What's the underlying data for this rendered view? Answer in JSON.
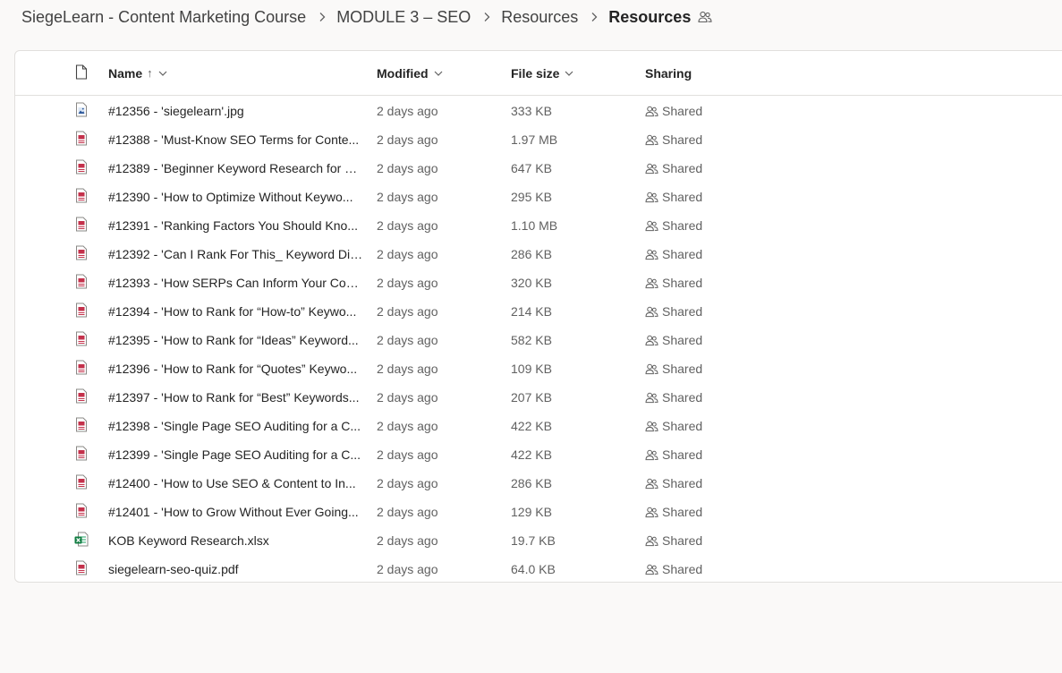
{
  "breadcrumb": {
    "items": [
      "SiegeLearn - Content Marketing Course",
      "MODULE 3 – SEO",
      "Resources"
    ],
    "current": "Resources"
  },
  "columns": {
    "name": "Name",
    "name_sort_arrow": "↑",
    "modified": "Modified",
    "size": "File size",
    "sharing": "Sharing"
  },
  "files": [
    {
      "icon": "image-file-icon",
      "name": "#12356 - 'siegelearn'.jpg",
      "modified": "2 days ago",
      "size": "333 KB",
      "sharing": "Shared"
    },
    {
      "icon": "pdf-file-icon",
      "name": "#12388 - 'Must-Know SEO Terms for Conte...",
      "modified": "2 days ago",
      "size": "1.97 MB",
      "sharing": "Shared"
    },
    {
      "icon": "pdf-file-icon",
      "name": "#12389 - 'Beginner Keyword Research for C...",
      "modified": "2 days ago",
      "size": "647 KB",
      "sharing": "Shared"
    },
    {
      "icon": "pdf-file-icon",
      "name": "#12390 - 'How to Optimize Without Keywo...",
      "modified": "2 days ago",
      "size": "295 KB",
      "sharing": "Shared"
    },
    {
      "icon": "pdf-file-icon",
      "name": "#12391 - 'Ranking Factors You Should Kno...",
      "modified": "2 days ago",
      "size": "1.10 MB",
      "sharing": "Shared"
    },
    {
      "icon": "pdf-file-icon",
      "name": "#12392 - 'Can I Rank For This_ Keyword Diff...",
      "modified": "2 days ago",
      "size": "286 KB",
      "sharing": "Shared"
    },
    {
      "icon": "pdf-file-icon",
      "name": "#12393 - 'How SERPs Can Inform Your Cont...",
      "modified": "2 days ago",
      "size": "320 KB",
      "sharing": "Shared"
    },
    {
      "icon": "pdf-file-icon",
      "name": "#12394 - 'How to Rank for “How-to” Keywo...",
      "modified": "2 days ago",
      "size": "214 KB",
      "sharing": "Shared"
    },
    {
      "icon": "pdf-file-icon",
      "name": "#12395 - 'How to Rank for “Ideas” Keyword...",
      "modified": "2 days ago",
      "size": "582 KB",
      "sharing": "Shared"
    },
    {
      "icon": "pdf-file-icon",
      "name": "#12396 - 'How to Rank for “Quotes” Keywo...",
      "modified": "2 days ago",
      "size": "109 KB",
      "sharing": "Shared"
    },
    {
      "icon": "pdf-file-icon",
      "name": "#12397 - 'How to Rank for “Best” Keywords...",
      "modified": "2 days ago",
      "size": "207 KB",
      "sharing": "Shared"
    },
    {
      "icon": "pdf-file-icon",
      "name": "#12398 - 'Single Page SEO Auditing for a C...",
      "modified": "2 days ago",
      "size": "422 KB",
      "sharing": "Shared"
    },
    {
      "icon": "pdf-file-icon",
      "name": "#12399 - 'Single Page SEO Auditing for a C...",
      "modified": "2 days ago",
      "size": "422 KB",
      "sharing": "Shared"
    },
    {
      "icon": "pdf-file-icon",
      "name": "#12400 - 'How to Use SEO & Content to In...",
      "modified": "2 days ago",
      "size": "286 KB",
      "sharing": "Shared"
    },
    {
      "icon": "pdf-file-icon",
      "name": "#12401 - 'How to Grow Without Ever Going...",
      "modified": "2 days ago",
      "size": "129 KB",
      "sharing": "Shared"
    },
    {
      "icon": "excel-file-icon",
      "name": "KOB Keyword Research.xlsx",
      "modified": "2 days ago",
      "size": "19.7 KB",
      "sharing": "Shared"
    },
    {
      "icon": "pdf-file-icon",
      "name": "siegelearn-seo-quiz.pdf",
      "modified": "2 days ago",
      "size": "64.0 KB",
      "sharing": "Shared"
    }
  ],
  "colors": {
    "pdf_accent": "#c4314b",
    "excel_accent": "#107c41",
    "image_accent": "#2b579a",
    "text_secondary": "#616161"
  }
}
